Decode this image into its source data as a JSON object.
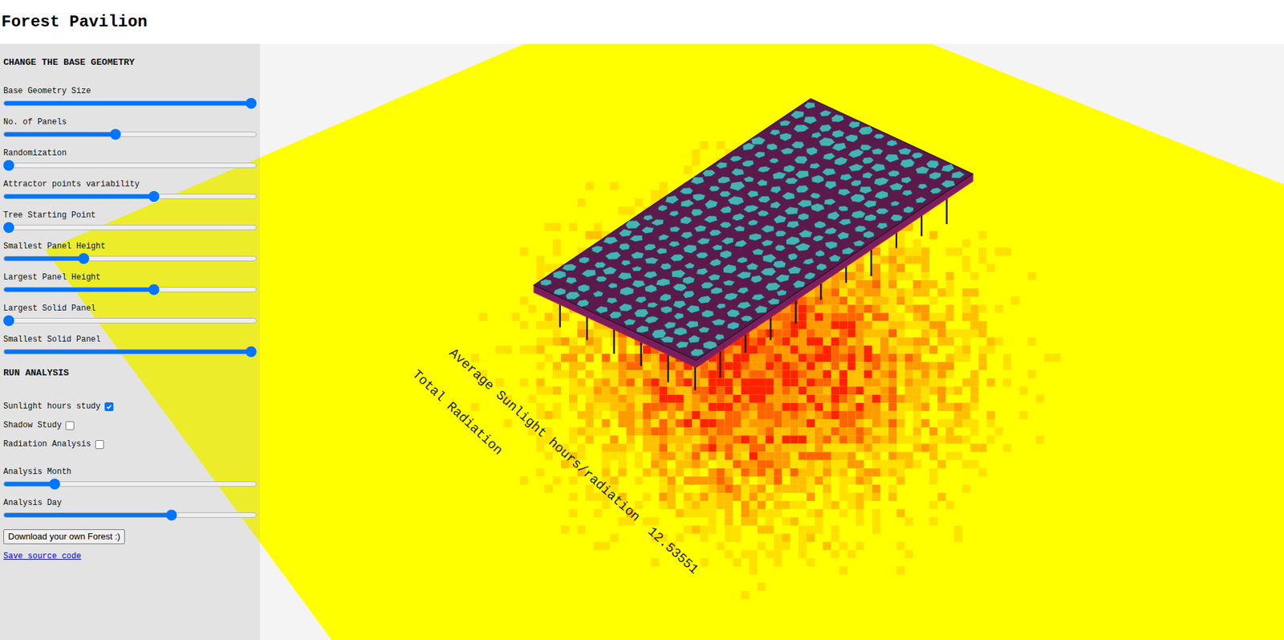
{
  "page": {
    "title": "Forest Pavilion"
  },
  "sidebar": {
    "sections": [
      {
        "title": "CHANGE THE BASE GEOMETRY",
        "controls": [
          {
            "kind": "slider",
            "label": "Base Geometry Size",
            "level": 1.0
          },
          {
            "kind": "slider",
            "label": "No. of Panels",
            "level": 0.44
          },
          {
            "kind": "slider",
            "label": "Randomization",
            "level": 0.0
          },
          {
            "kind": "slider",
            "label": "Attractor points variability",
            "level": 0.6
          },
          {
            "kind": "slider",
            "label": "Tree Starting Point",
            "level": 0.0
          },
          {
            "kind": "slider",
            "label": "Smallest Panel Height",
            "level": 0.31
          },
          {
            "kind": "slider",
            "label": "Largest Panel Height",
            "level": 0.6
          },
          {
            "kind": "slider",
            "label": "Largest Solid Panel",
            "level": 0.0
          },
          {
            "kind": "slider",
            "label": "Smallest Solid Panel",
            "level": 1.0
          }
        ]
      },
      {
        "title": "RUN ANALYSIS",
        "controls": [
          {
            "kind": "checkbox",
            "label": "Sunlight hours study",
            "checked": true
          },
          {
            "kind": "checkbox",
            "label": "Shadow Study",
            "checked": false
          },
          {
            "kind": "checkbox",
            "label": "Radiation Analysis",
            "checked": false
          },
          {
            "kind": "slider",
            "label": "Analysis Month",
            "level": 0.19
          },
          {
            "kind": "slider",
            "label": "Analysis Day",
            "level": 0.67
          }
        ]
      }
    ],
    "button": "Download your own Forest :)",
    "link": "Save source code"
  },
  "viewport": {
    "labels": [
      "Average Sunlight hours/radiation  12.53551",
      "Total Radiation"
    ]
  }
}
